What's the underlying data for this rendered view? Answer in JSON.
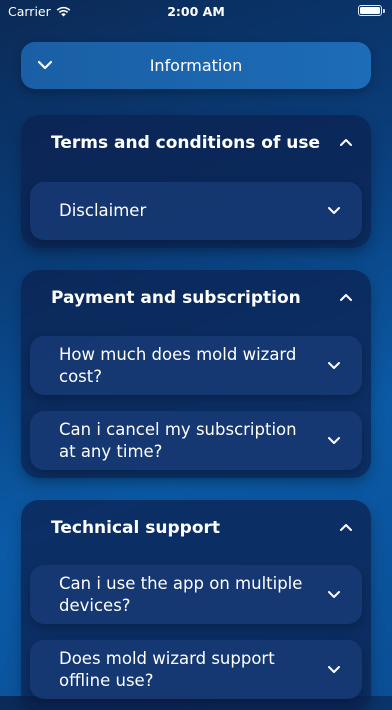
{
  "status_bar": {
    "carrier": "Carrier",
    "time": "2:00 AM"
  },
  "header": {
    "title": "Information"
  },
  "sections": [
    {
      "title": "Terms and conditions of use",
      "items": [
        {
          "label": "Disclaimer"
        }
      ]
    },
    {
      "title": "Payment and subscription",
      "items": [
        {
          "label": "How much does mold wizard cost?"
        },
        {
          "label": "Can i cancel my subscription at any time?"
        }
      ]
    },
    {
      "title": "Technical support",
      "items": [
        {
          "label": "Can i use the app on multiple devices?"
        },
        {
          "label": "Does mold wizard support offline use?"
        }
      ]
    }
  ]
}
